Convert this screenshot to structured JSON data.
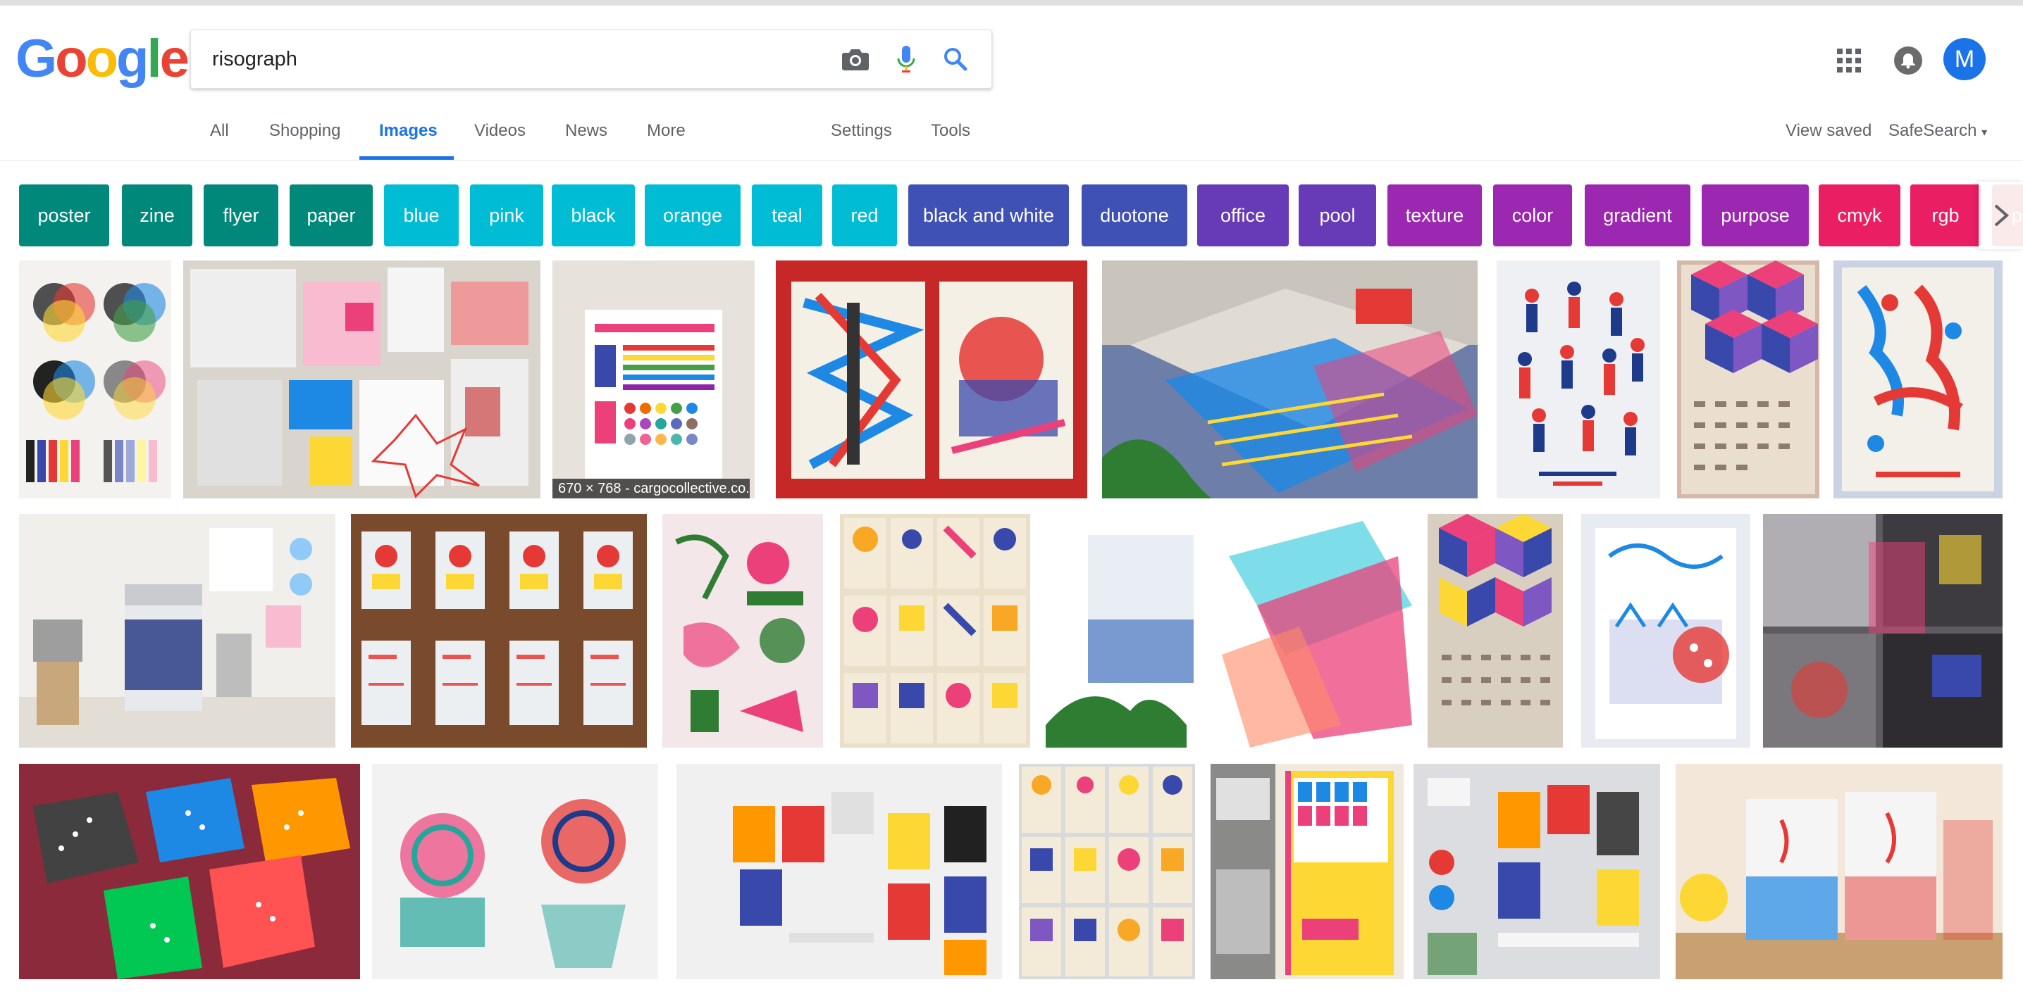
{
  "logo": {
    "letters": [
      "G",
      "o",
      "o",
      "g",
      "l",
      "e"
    ],
    "colors": [
      "#4285f4",
      "#ea4335",
      "#fbbc05",
      "#4285f4",
      "#34a853",
      "#ea4335"
    ]
  },
  "search": {
    "value": "risograph",
    "camera_icon": "camera-icon",
    "mic_icon": "mic-icon",
    "search_icon": "search-icon"
  },
  "header": {
    "apps_icon": "apps-grid-icon",
    "notifications_icon": "bell-icon",
    "avatar_letter": "M"
  },
  "tabs": {
    "all": "All",
    "shopping": "Shopping",
    "images": "Images",
    "videos": "Videos",
    "news": "News",
    "more": "More",
    "settings": "Settings",
    "tools": "Tools",
    "view_saved": "View saved",
    "safesearch": "SafeSearch"
  },
  "chips": [
    {
      "label": "poster",
      "color": "#00897b"
    },
    {
      "label": "zine",
      "color": "#00897b"
    },
    {
      "label": "flyer",
      "color": "#00897b"
    },
    {
      "label": "paper",
      "color": "#00897b"
    },
    {
      "label": "blue",
      "color": "#00bcd4"
    },
    {
      "label": "pink",
      "color": "#00bcd4"
    },
    {
      "label": "black",
      "color": "#00bcd4"
    },
    {
      "label": "orange",
      "color": "#00bcd4"
    },
    {
      "label": "teal",
      "color": "#00bcd4"
    },
    {
      "label": "red",
      "color": "#00bcd4"
    },
    {
      "label": "black and white",
      "color": "#3f51b5"
    },
    {
      "label": "duotone",
      "color": "#3f51b5"
    },
    {
      "label": "office",
      "color": "#673ab7"
    },
    {
      "label": "pool",
      "color": "#673ab7"
    },
    {
      "label": "texture",
      "color": "#9c27b0"
    },
    {
      "label": "color",
      "color": "#9c27b0"
    },
    {
      "label": "gradient",
      "color": "#9c27b0"
    },
    {
      "label": "purpose",
      "color": "#9c27b0"
    },
    {
      "label": "cmyk",
      "color": "#e91e63"
    },
    {
      "label": "rgb",
      "color": "#e91e63"
    },
    {
      "label": "pic",
      "color": "#e57373"
    }
  ],
  "results": {
    "caption": "670 × 768 - cargocollective.co...",
    "colors": [
      "#d9d4cc",
      "#b9b2aa",
      "#e7e3dc",
      "#c62828",
      "#6d7fa8",
      "#eef0f3",
      "#d4b9a8",
      "#c9d3e3",
      "#f0efec",
      "#7a4a2c",
      "#f3e7ea",
      "#eadfc9",
      "#e8eef4",
      "#f0c8d8",
      "#d8cfc0",
      "#e8ecf2",
      "#5d5b60",
      "#8b2a3a",
      "#f2f2f2",
      "#f0f0f0",
      "#d9dadc",
      "#efe9de",
      "#bfc4cc",
      "#dcdde0",
      "#f2e7d8"
    ]
  }
}
